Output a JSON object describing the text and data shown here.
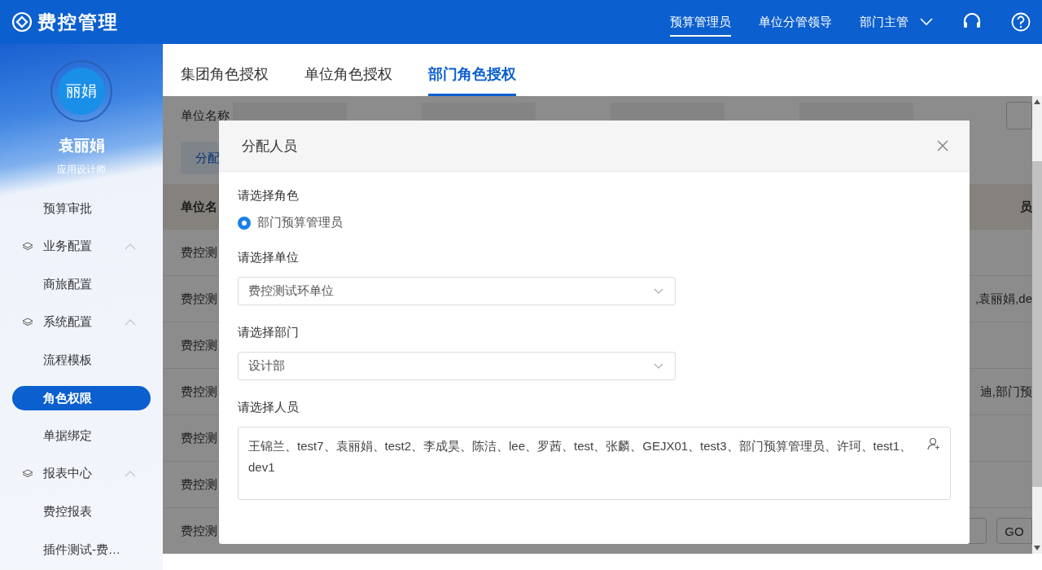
{
  "header": {
    "app_title": "费控管理",
    "roles": [
      {
        "label": "预算管理员",
        "selected": true
      },
      {
        "label": "单位分管领导",
        "selected": false
      },
      {
        "label": "部门主管",
        "selected": false
      }
    ]
  },
  "sidebar": {
    "user": {
      "avatar_text": "丽娟",
      "name": "袁丽娟",
      "role": "应用设计师"
    },
    "menu": [
      {
        "kind": "item",
        "label": "预算审批",
        "selected": false
      },
      {
        "kind": "group",
        "label": "业务配置",
        "expanded": true,
        "children": [
          {
            "kind": "item",
            "label": "商旅配置",
            "selected": false
          }
        ]
      },
      {
        "kind": "group",
        "label": "系统配置",
        "expanded": true,
        "children": [
          {
            "kind": "item",
            "label": "流程模板",
            "selected": false
          },
          {
            "kind": "item",
            "label": "角色权限",
            "selected": true
          },
          {
            "kind": "item",
            "label": "单据绑定",
            "selected": false
          }
        ]
      },
      {
        "kind": "group",
        "label": "报表中心",
        "expanded": true,
        "children": [
          {
            "kind": "item",
            "label": "费控报表",
            "selected": false
          },
          {
            "kind": "item",
            "label": "插件测试-费…",
            "selected": false
          }
        ]
      }
    ]
  },
  "tabs": [
    {
      "label": "集团角色授权",
      "selected": false
    },
    {
      "label": "单位角色授权",
      "selected": false
    },
    {
      "label": "部门角色授权",
      "selected": true
    }
  ],
  "filter_label": "单位名称",
  "assign_button": "分配",
  "table": {
    "columns": [
      "单位名",
      "员"
    ],
    "rows": [
      {
        "column_1": "费控测"
      },
      {
        "column_1": "费控测",
        "column_2": ",袁丽娟,de"
      },
      {
        "column_1": "费控测"
      },
      {
        "column_1": "费控测",
        "column_2": "迪,部门预"
      },
      {
        "column_1": "费控测"
      },
      {
        "column_1": "费控测"
      },
      {
        "column_1": "费控测"
      }
    ]
  },
  "pager": {
    "go_button": "GO"
  },
  "dialog": {
    "title": "分配人员",
    "role_label": "请选择角色",
    "roles": [
      {
        "label": "部门预算管理员",
        "selected": true
      }
    ],
    "unit_label": "请选择单位",
    "unit_value": "费控测试环单位",
    "dept_label": "请选择部门",
    "dept_value": "设计部",
    "people_label": "请选择人员",
    "people_value": "王锦兰、test7、袁丽娟、test2、李成昊、陈洁、lee、罗茜、test、张麟、GEJX01、test3、部门预算管理员、许珂、test1、dev1"
  }
}
